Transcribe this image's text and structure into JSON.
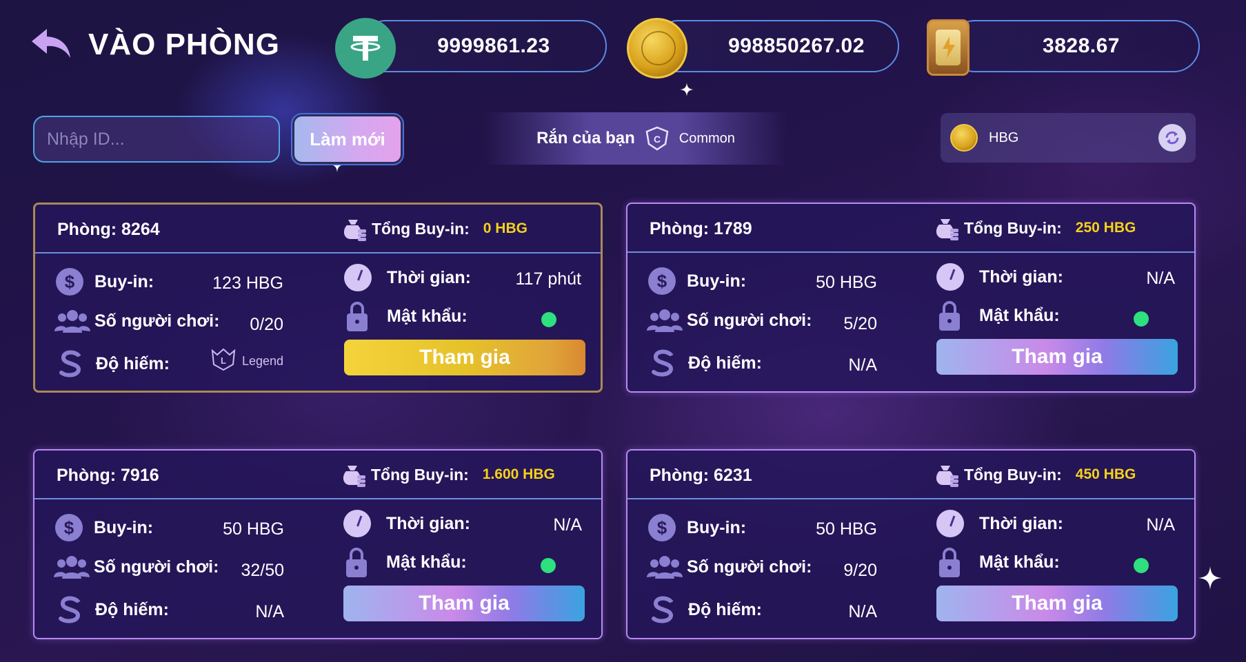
{
  "header": {
    "title": "VÀO PHÒNG",
    "balances": [
      {
        "icon": "tether-coin-icon",
        "value": "9999861.23"
      },
      {
        "icon": "hero-gold-coin-icon",
        "value": "998850267.02"
      },
      {
        "icon": "energy-card-icon",
        "value": "3828.67"
      }
    ]
  },
  "toolbar": {
    "search_placeholder": "Nhập ID...",
    "refresh_label": "Làm mới",
    "snake_label": "Rắn của bạn",
    "snake_rarity": "Common",
    "token_label": "HBG"
  },
  "rooms": [
    {
      "title": "Phòng: 8264",
      "total_label": "Tổng Buy-in:",
      "total_value": "0 HBG",
      "buyin_label": "Buy-in:",
      "buyin_value": "123 HBG",
      "players_label": "Số người chơi:",
      "players_value": "0/20",
      "rarity_label": "Độ hiếm:",
      "rarity_value": "Legend",
      "time_label": "Thời gian:",
      "time_value": "117 phút",
      "password_label": "Mật khẩu:",
      "join_label": "Tham gia"
    },
    {
      "title": "Phòng: 1789",
      "total_label": "Tổng Buy-in:",
      "total_value": "250 HBG",
      "buyin_label": "Buy-in:",
      "buyin_value": "50 HBG",
      "players_label": "Số người chơi:",
      "players_value": "5/20",
      "rarity_label": "Độ hiếm:",
      "rarity_value": "N/A",
      "time_label": "Thời gian:",
      "time_value": "N/A",
      "password_label": "Mật khẩu:",
      "join_label": "Tham gia"
    },
    {
      "title": "Phòng: 7916",
      "total_label": "Tổng Buy-in:",
      "total_value": "1.600 HBG",
      "buyin_label": "Buy-in:",
      "buyin_value": "50 HBG",
      "players_label": "Số người chơi:",
      "players_value": "32/50",
      "rarity_label": "Độ hiếm:",
      "rarity_value": "N/A",
      "time_label": "Thời gian:",
      "time_value": "N/A",
      "password_label": "Mật khẩu:",
      "join_label": "Tham gia"
    },
    {
      "title": "Phòng: 6231",
      "total_label": "Tổng Buy-in:",
      "total_value": "450 HBG",
      "buyin_label": "Buy-in:",
      "buyin_value": "50 HBG",
      "players_label": "Số người chơi:",
      "players_value": "9/20",
      "rarity_label": "Độ hiếm:",
      "rarity_value": "N/A",
      "time_label": "Thời gian:",
      "time_value": "N/A",
      "password_label": "Mật khẩu:",
      "join_label": "Tham gia"
    }
  ],
  "colors": {
    "accent_yellow": "#f6d21a",
    "password_dot": "#2ee07e",
    "card_border": "#b78bf0",
    "gold_border": "#a98a56"
  }
}
